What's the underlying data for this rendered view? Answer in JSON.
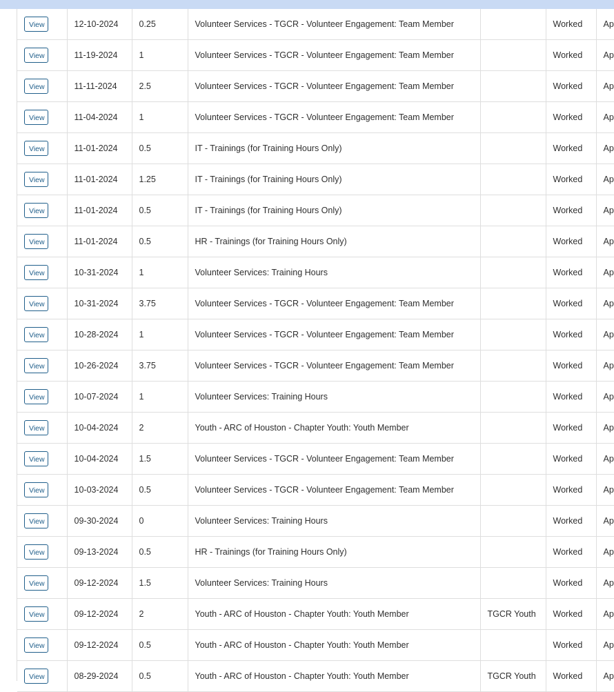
{
  "rows": [
    {
      "action": "View",
      "date": "12-10-2024",
      "hours": "0.25",
      "position": "Volunteer Services - TGCR - Volunteer Engagement: Team Member",
      "team": "",
      "type": "Worked",
      "status": "Ap"
    },
    {
      "action": "View",
      "date": "11-19-2024",
      "hours": "1",
      "position": "Volunteer Services - TGCR - Volunteer Engagement: Team Member",
      "team": "",
      "type": "Worked",
      "status": "Ap"
    },
    {
      "action": "View",
      "date": "11-11-2024",
      "hours": "2.5",
      "position": "Volunteer Services - TGCR - Volunteer Engagement: Team Member",
      "team": "",
      "type": "Worked",
      "status": "Ap"
    },
    {
      "action": "View",
      "date": "11-04-2024",
      "hours": "1",
      "position": "Volunteer Services - TGCR - Volunteer Engagement: Team Member",
      "team": "",
      "type": "Worked",
      "status": "Ap"
    },
    {
      "action": "View",
      "date": "11-01-2024",
      "hours": "0.5",
      "position": "IT - Trainings (for Training Hours Only)",
      "team": "",
      "type": "Worked",
      "status": "Ap"
    },
    {
      "action": "View",
      "date": "11-01-2024",
      "hours": "1.25",
      "position": "IT - Trainings (for Training Hours Only)",
      "team": "",
      "type": "Worked",
      "status": "Ap"
    },
    {
      "action": "View",
      "date": "11-01-2024",
      "hours": "0.5",
      "position": "IT - Trainings (for Training Hours Only)",
      "team": "",
      "type": "Worked",
      "status": "Ap"
    },
    {
      "action": "View",
      "date": "11-01-2024",
      "hours": "0.5",
      "position": "HR - Trainings (for Training Hours Only)",
      "team": "",
      "type": "Worked",
      "status": "Ap"
    },
    {
      "action": "View",
      "date": "10-31-2024",
      "hours": "1",
      "position": "Volunteer Services: Training Hours",
      "team": "",
      "type": "Worked",
      "status": "Ap"
    },
    {
      "action": "View",
      "date": "10-31-2024",
      "hours": "3.75",
      "position": "Volunteer Services - TGCR - Volunteer Engagement: Team Member",
      "team": "",
      "type": "Worked",
      "status": "Ap"
    },
    {
      "action": "View",
      "date": "10-28-2024",
      "hours": "1",
      "position": "Volunteer Services - TGCR - Volunteer Engagement: Team Member",
      "team": "",
      "type": "Worked",
      "status": "Ap"
    },
    {
      "action": "View",
      "date": "10-26-2024",
      "hours": "3.75",
      "position": "Volunteer Services - TGCR - Volunteer Engagement: Team Member",
      "team": "",
      "type": "Worked",
      "status": "Ap"
    },
    {
      "action": "View",
      "date": "10-07-2024",
      "hours": "1",
      "position": "Volunteer Services: Training Hours",
      "team": "",
      "type": "Worked",
      "status": "Ap"
    },
    {
      "action": "View",
      "date": "10-04-2024",
      "hours": "2",
      "position": "Youth - ARC of Houston - Chapter Youth: Youth Member",
      "team": "",
      "type": "Worked",
      "status": "Ap"
    },
    {
      "action": "View",
      "date": "10-04-2024",
      "hours": "1.5",
      "position": "Volunteer Services - TGCR - Volunteer Engagement: Team Member",
      "team": "",
      "type": "Worked",
      "status": "Ap"
    },
    {
      "action": "View",
      "date": "10-03-2024",
      "hours": "0.5",
      "position": "Volunteer Services - TGCR - Volunteer Engagement: Team Member",
      "team": "",
      "type": "Worked",
      "status": "Ap"
    },
    {
      "action": "View",
      "date": "09-30-2024",
      "hours": "0",
      "position": "Volunteer Services: Training Hours",
      "team": "",
      "type": "Worked",
      "status": "Ap"
    },
    {
      "action": "View",
      "date": "09-13-2024",
      "hours": "0.5",
      "position": "HR - Trainings (for Training Hours Only)",
      "team": "",
      "type": "Worked",
      "status": "Ap"
    },
    {
      "action": "View",
      "date": "09-12-2024",
      "hours": "1.5",
      "position": "Volunteer Services: Training Hours",
      "team": "",
      "type": "Worked",
      "status": "Ap"
    },
    {
      "action": "View",
      "date": "09-12-2024",
      "hours": "2",
      "position": "Youth - ARC of Houston - Chapter Youth: Youth Member",
      "team": "TGCR Youth",
      "type": "Worked",
      "status": "Ap"
    },
    {
      "action": "View",
      "date": "09-12-2024",
      "hours": "0.5",
      "position": "Youth - ARC of Houston - Chapter Youth: Youth Member",
      "team": "",
      "type": "Worked",
      "status": "Ap"
    },
    {
      "action": "View",
      "date": "08-29-2024",
      "hours": "0.5",
      "position": "Youth - ARC of Houston - Chapter Youth: Youth Member",
      "team": "TGCR Youth",
      "type": "Worked",
      "status": "Ap"
    }
  ]
}
